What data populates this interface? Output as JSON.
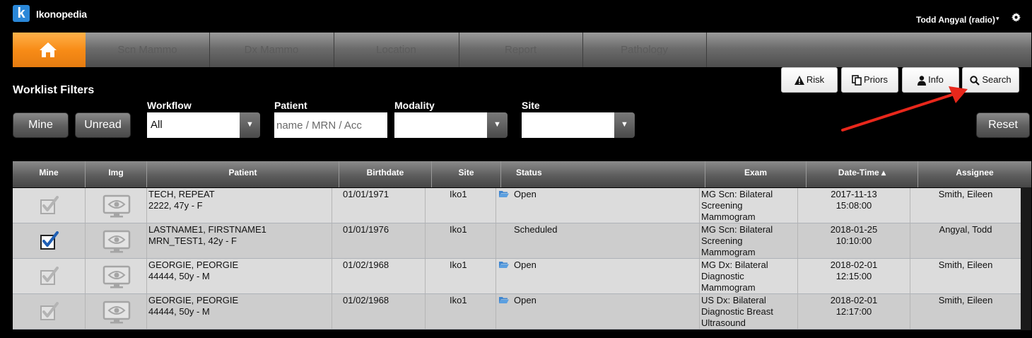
{
  "app": {
    "logo_letter": "k",
    "title": "Ikonopedia"
  },
  "user": {
    "name": "Todd Angyal (radio)",
    "caret": "▾",
    "settings_icon": "gear-icon"
  },
  "nav": {
    "home_icon": "home-icon",
    "tabs": [
      "Scn Mammo",
      "Dx Mammo",
      "Location",
      "Report",
      "Pathology"
    ]
  },
  "filters": {
    "title": "Worklist Filters",
    "mine_label": "Mine",
    "unread_label": "Unread",
    "workflow": {
      "label": "Workflow",
      "value": "All"
    },
    "patient": {
      "label": "Patient",
      "placeholder": "name / MRN / Acc",
      "value": ""
    },
    "modality": {
      "label": "Modality",
      "value": ""
    },
    "site": {
      "label": "Site",
      "value": ""
    },
    "reset_label": "Reset"
  },
  "actions": {
    "risk": "Risk",
    "priors": "Priors",
    "info": "Info",
    "search": "Search"
  },
  "table": {
    "headers": [
      "Mine",
      "Img",
      "Patient",
      "Birthdate",
      "Site",
      "Status",
      "Exam",
      "Date-Time ▴",
      "Assignee"
    ],
    "rows": [
      {
        "mine": false,
        "patient_name": "TECH, REPEAT",
        "patient_id": "2222, 47y - F",
        "birthdate": "01/01/1971",
        "site": "Iko1",
        "status": "Open",
        "has_folder": true,
        "exam": [
          "MG Scn: Bilateral",
          "Screening",
          "Mammogram"
        ],
        "date": "2017-11-13",
        "time": "15:08:00",
        "assignee": "Smith, Eileen"
      },
      {
        "mine": true,
        "patient_name": "LASTNAME1, FIRSTNAME1",
        "patient_id": "MRN_TEST1, 42y - F",
        "birthdate": "01/01/1976",
        "site": "Iko1",
        "status": "Scheduled",
        "has_folder": false,
        "exam": [
          "MG Scn: Bilateral",
          "Screening",
          "Mammogram"
        ],
        "date": "2018-01-25",
        "time": "10:10:00",
        "assignee": "Angyal, Todd"
      },
      {
        "mine": false,
        "patient_name": "GEORGIE, PEORGIE",
        "patient_id": "44444, 50y - M",
        "birthdate": "01/02/1968",
        "site": "Iko1",
        "status": "Open",
        "has_folder": true,
        "exam": [
          "MG Dx: Bilateral",
          "Diagnostic",
          "Mammogram"
        ],
        "date": "2018-02-01",
        "time": "12:15:00",
        "assignee": "Smith, Eileen"
      },
      {
        "mine": false,
        "patient_name": "GEORGIE, PEORGIE",
        "patient_id": "44444, 50y - M",
        "birthdate": "01/02/1968",
        "site": "Iko1",
        "status": "Open",
        "has_folder": true,
        "exam": [
          "US Dx: Bilateral",
          "Diagnostic Breast",
          "Ultrasound"
        ],
        "date": "2018-02-01",
        "time": "12:17:00",
        "assignee": "Smith, Eileen"
      }
    ]
  },
  "colors": {
    "accent_orange": "#f88c17",
    "logo_blue": "#2a87d8",
    "check_blue": "#1f5fb4",
    "annotation_red": "#e8271b",
    "folder_blue": "#3f86d0"
  }
}
